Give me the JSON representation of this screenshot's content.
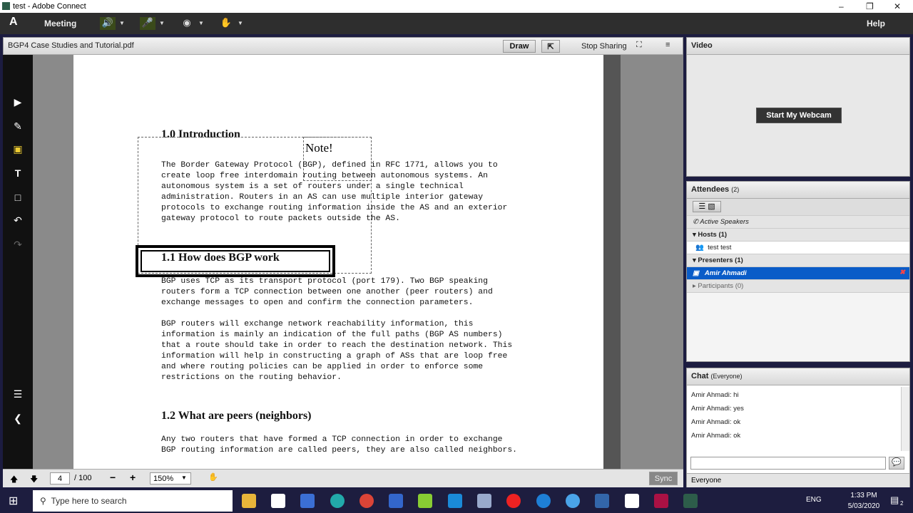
{
  "window": {
    "title": "test - Adobe Connect"
  },
  "menubar": {
    "logo": "Adobe",
    "meeting": "Meeting",
    "help": "Help"
  },
  "share": {
    "filename": "BGP4 Case Studies and Tutorial.pdf",
    "draw": "Draw",
    "stop_sharing": "Stop Sharing"
  },
  "pdf": {
    "h1": "1.0  Introduction",
    "note": "Note!",
    "p1": [
      "The Border Gateway Protocol (BGP), defined in RFC 1771, allows you to",
      "create loop free interdomain routing between autonomous systems. An",
      "autonomous system is a set of routers under a single technical",
      "administration. Routers in an AS can use multiple interior gateway",
      "protocols to exchange routing information inside the AS and an exterior",
      "gateway protocol to route packets outside the AS."
    ],
    "h2": "1.1  How does BGP work",
    "p2": [
      "BGP uses TCP as its transport protocol (port 179). Two BGP speaking",
      "routers form a TCP connection between one another (peer routers) and",
      "exchange messages to open and confirm the connection parameters."
    ],
    "p3": [
      "BGP routers will exchange network reachability information, this",
      "information is mainly an indication of the full paths (BGP AS numbers)",
      "that a route should take in order to reach the destination network. This",
      "information will help in constructing a graph of ASs that are loop free",
      "and where routing policies can be applied in order to enforce some",
      "restrictions on the routing behavior."
    ],
    "h3": "1.2  What are peers (neighbors)",
    "p4": [
      "Any two routers that have formed a TCP connection in order to exchange",
      "BGP routing information are called peers, they are also called neighbors."
    ]
  },
  "bottombar": {
    "page": "4",
    "total": "/ 100",
    "zoom": "150%",
    "sync": "Sync"
  },
  "video": {
    "title": "Video",
    "start_webcam": "Start My Webcam"
  },
  "attendees": {
    "title": "Attendees",
    "count": "(2)",
    "active_speakers": "Active Speakers",
    "hosts": "Hosts (1)",
    "host_name": "test test",
    "presenters": "Presenters (1)",
    "presenter_name": "Amir Ahmadi",
    "participants": "Participants (0)",
    "highlight": "#0a5cc8"
  },
  "chat": {
    "title": "Chat",
    "scope": "(Everyone)",
    "messages": [
      "Amir Ahmadi: hi",
      "Amir Ahmadi: yes",
      "Amir Ahmadi: ok",
      "Amir Ahmadi: ok"
    ],
    "recipient": "Everyone"
  },
  "taskbar": {
    "search_placeholder": "Type here to search",
    "lang": "ENG",
    "time": "1:33 PM",
    "date": "5/03/2020",
    "notif": "2"
  }
}
